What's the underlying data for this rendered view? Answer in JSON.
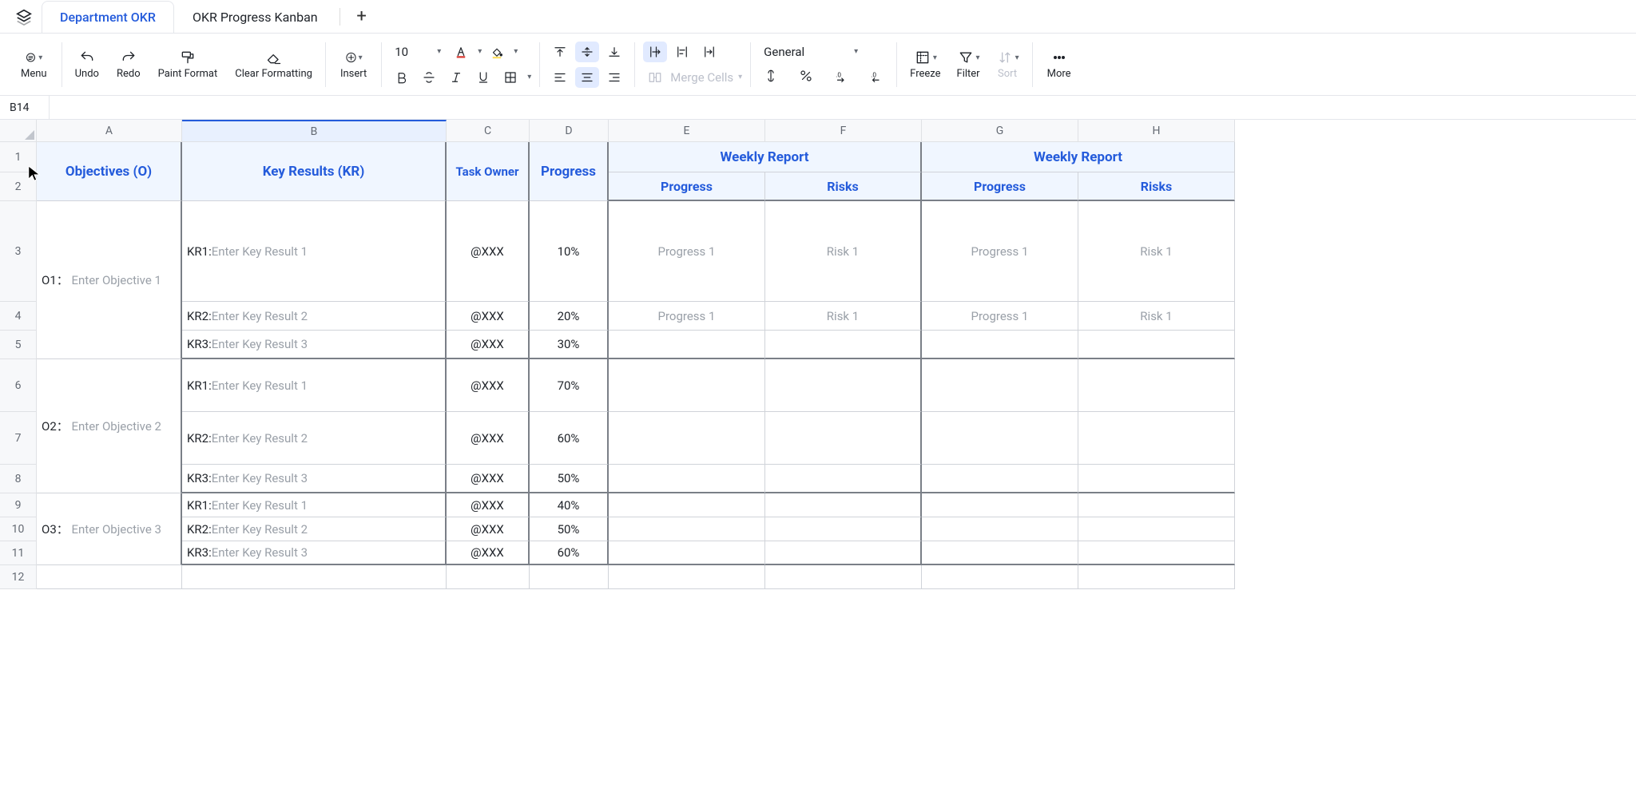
{
  "tabs": {
    "active": "Department OKR",
    "other": "OKR Progress Kanban"
  },
  "toolbar": {
    "menu": "Menu",
    "undo": "Undo",
    "redo": "Redo",
    "paint": "Paint Format",
    "clear": "Clear Formatting",
    "insert": "Insert",
    "font_size": "10",
    "merge": "Merge Cells",
    "number_format": "General",
    "freeze": "Freeze",
    "filter": "Filter",
    "sort": "Sort",
    "more": "More"
  },
  "namebox": "B14",
  "columns": [
    "A",
    "B",
    "C",
    "D",
    "E",
    "F",
    "G",
    "H"
  ],
  "rows": [
    "1",
    "2",
    "3",
    "4",
    "5",
    "6",
    "7",
    "8",
    "9",
    "10",
    "11",
    "12"
  ],
  "headers": {
    "objectives": "Objectives (O)",
    "key_results": "Key Results (KR)",
    "task_owner": "Task Owner",
    "progress": "Progress",
    "weekly": "Weekly Report",
    "prog": "Progress",
    "risks": "Risks"
  },
  "okr": {
    "o": [
      {
        "label": "O1：",
        "text": "Enter Objective 1",
        "kr": [
          {
            "pre": "KR1: ",
            "txt": "Enter Key Result 1",
            "owner": "@XXX",
            "prog": "10%",
            "p1": "Progress 1",
            "r1": "Risk 1",
            "p2": "Progress 1",
            "r2": "Risk 1"
          },
          {
            "pre": "KR2: ",
            "txt": "Enter Key Result 2",
            "owner": "@XXX",
            "prog": "20%",
            "p1": "Progress 1",
            "r1": "Risk 1",
            "p2": "Progress 1",
            "r2": "Risk 1"
          },
          {
            "pre": "KR3: ",
            "txt": "Enter Key Result 3",
            "owner": "@XXX",
            "prog": "30%",
            "p1": "",
            "r1": "",
            "p2": "",
            "r2": ""
          }
        ]
      },
      {
        "label": "O2：",
        "text": "Enter Objective 2",
        "kr": [
          {
            "pre": "KR1: ",
            "txt": "Enter Key Result 1",
            "owner": "@XXX",
            "prog": "70%",
            "p1": "",
            "r1": "",
            "p2": "",
            "r2": ""
          },
          {
            "pre": "KR2: ",
            "txt": "Enter Key Result 2",
            "owner": "@XXX",
            "prog": "60%",
            "p1": "",
            "r1": "",
            "p2": "",
            "r2": ""
          },
          {
            "pre": "KR3: ",
            "txt": "Enter Key Result 3",
            "owner": "@XXX",
            "prog": "50%",
            "p1": "",
            "r1": "",
            "p2": "",
            "r2": ""
          }
        ]
      },
      {
        "label": "O3：",
        "text": "Enter Objective 3",
        "kr": [
          {
            "pre": "KR1: ",
            "txt": "Enter Key Result 1",
            "owner": "@XXX",
            "prog": "40%",
            "p1": "",
            "r1": "",
            "p2": "",
            "r2": ""
          },
          {
            "pre": "KR2: ",
            "txt": "Enter Key Result 2",
            "owner": "@XXX",
            "prog": "50%",
            "p1": "",
            "r1": "",
            "p2": "",
            "r2": ""
          },
          {
            "pre": "KR3: ",
            "txt": "Enter Key Result 3",
            "owner": "@XXX",
            "prog": "60%",
            "p1": "",
            "r1": "",
            "p2": "",
            "r2": ""
          }
        ]
      }
    ]
  }
}
